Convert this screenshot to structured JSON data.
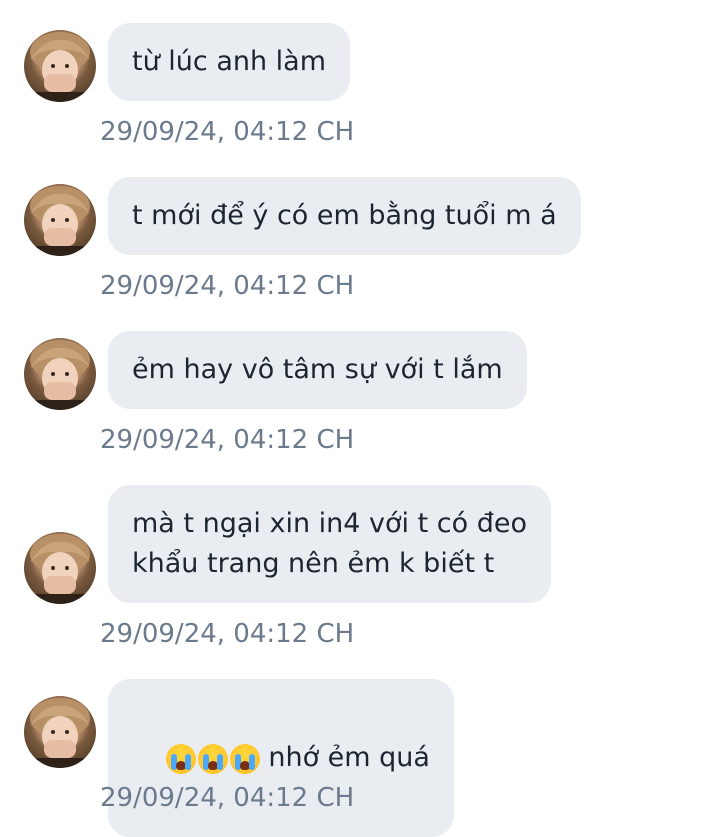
{
  "messages": [
    {
      "text": "từ lúc anh làm",
      "timestamp": "29/09/24, 04:12 CH"
    },
    {
      "text": "t mới để ý có em bằng tuổi m á",
      "timestamp": "29/09/24, 04:12 CH"
    },
    {
      "text": "ẻm hay vô tâm sự với t lắm",
      "timestamp": "29/09/24, 04:12 CH"
    },
    {
      "text": "mà t ngại xin in4 với t có đeo\nkhẩu trang nên ẻm k biết t",
      "timestamp": "29/09/24, 04:12 CH"
    },
    {
      "emojis": [
        "loudly-crying-face",
        "loudly-crying-face",
        "loudly-crying-face"
      ],
      "text": "nhớ ẻm quá",
      "timestamp": "29/09/24, 04:12 CH"
    }
  ],
  "colors": {
    "bubble_bg": "#e9edf2",
    "text": "#1c2530",
    "timestamp": "#6b7a8c"
  }
}
